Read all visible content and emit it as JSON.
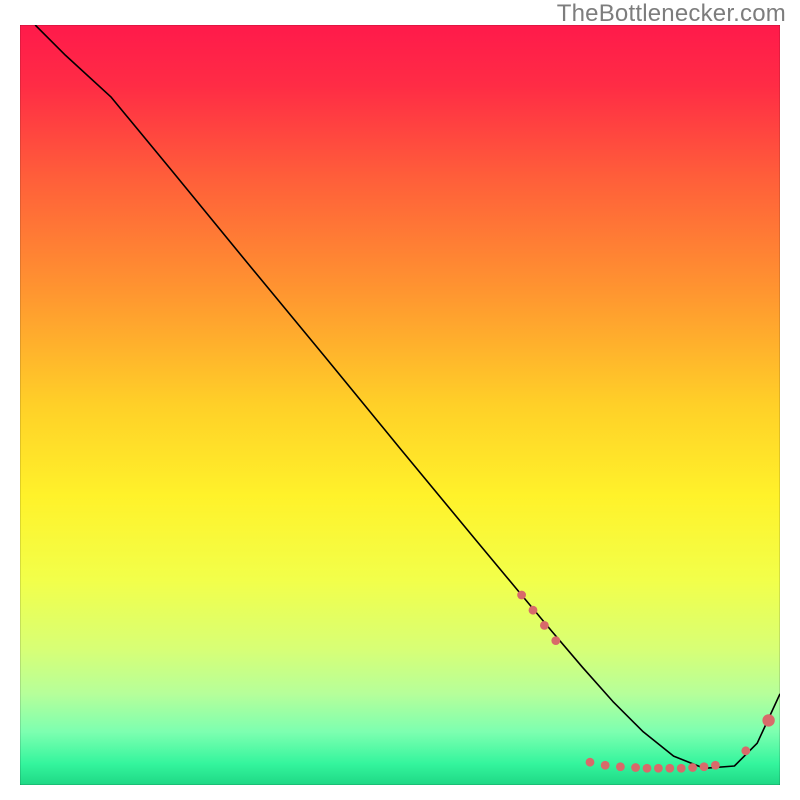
{
  "watermark": "TheBottlenecker.com",
  "chart_data": {
    "type": "line",
    "title": "",
    "xlabel": "",
    "ylabel": "",
    "xlim": [
      0,
      100
    ],
    "ylim": [
      0,
      100
    ],
    "background_gradient": {
      "stops": [
        {
          "offset": 0.0,
          "color": "#ff1a4b"
        },
        {
          "offset": 0.08,
          "color": "#ff2c45"
        },
        {
          "offset": 0.2,
          "color": "#ff5e3a"
        },
        {
          "offset": 0.35,
          "color": "#ff9530"
        },
        {
          "offset": 0.5,
          "color": "#ffd028"
        },
        {
          "offset": 0.62,
          "color": "#fff22a"
        },
        {
          "offset": 0.73,
          "color": "#f2ff4a"
        },
        {
          "offset": 0.82,
          "color": "#d8ff75"
        },
        {
          "offset": 0.88,
          "color": "#b6ff9a"
        },
        {
          "offset": 0.93,
          "color": "#7dffb0"
        },
        {
          "offset": 0.972,
          "color": "#34f59d"
        },
        {
          "offset": 1.0,
          "color": "#1fd885"
        }
      ]
    },
    "series": [
      {
        "name": "curve",
        "x": [
          2,
          6,
          12,
          20,
          30,
          40,
          50,
          60,
          66,
          70,
          74,
          78,
          82,
          86,
          90,
          94,
          97,
          100
        ],
        "y": [
          100,
          96,
          90.5,
          80.8,
          68.6,
          56.5,
          44.3,
          32.2,
          25,
          20.2,
          15.5,
          11,
          7,
          3.8,
          2.2,
          2.5,
          5.5,
          12
        ],
        "stroke": "#000000",
        "stroke_width": 1.6
      }
    ],
    "marker_points": {
      "color": "#d86a6a",
      "radius_small": 4.4,
      "radius_large": 6.2,
      "points": [
        {
          "x": 66.0,
          "y": 25.0,
          "r": "small"
        },
        {
          "x": 67.5,
          "y": 23.0,
          "r": "small"
        },
        {
          "x": 69.0,
          "y": 21.0,
          "r": "small"
        },
        {
          "x": 70.5,
          "y": 19.0,
          "r": "small"
        },
        {
          "x": 75.0,
          "y": 3.0,
          "r": "small"
        },
        {
          "x": 77.0,
          "y": 2.6,
          "r": "small"
        },
        {
          "x": 79.0,
          "y": 2.4,
          "r": "small"
        },
        {
          "x": 81.0,
          "y": 2.3,
          "r": "small"
        },
        {
          "x": 82.5,
          "y": 2.2,
          "r": "small"
        },
        {
          "x": 84.0,
          "y": 2.2,
          "r": "small"
        },
        {
          "x": 85.5,
          "y": 2.2,
          "r": "small"
        },
        {
          "x": 87.0,
          "y": 2.2,
          "r": "small"
        },
        {
          "x": 88.5,
          "y": 2.3,
          "r": "small"
        },
        {
          "x": 90.0,
          "y": 2.4,
          "r": "small"
        },
        {
          "x": 91.5,
          "y": 2.6,
          "r": "small"
        },
        {
          "x": 95.5,
          "y": 4.5,
          "r": "small"
        },
        {
          "x": 98.5,
          "y": 8.5,
          "r": "large"
        }
      ]
    }
  }
}
